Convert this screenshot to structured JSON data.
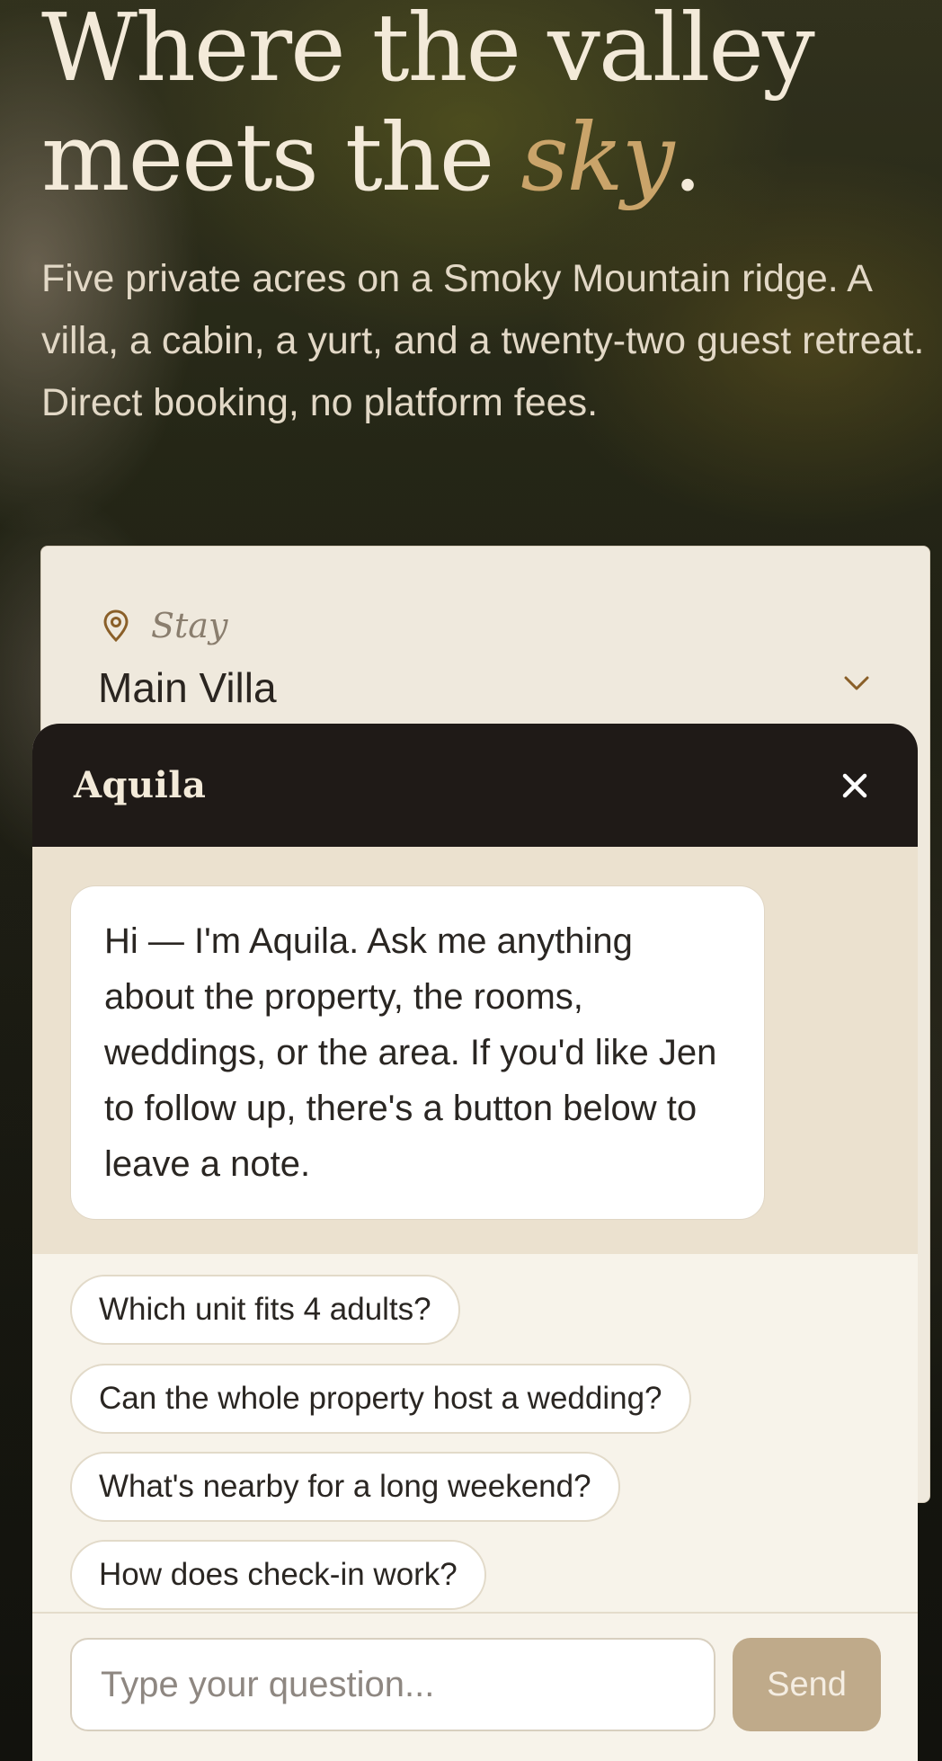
{
  "hero": {
    "headline_part1": "Where the valley meets the ",
    "headline_accent": "sky",
    "headline_end": ".",
    "subhead": "Five private acres on a Smoky Mountain ridge. A villa, a cabin, a yurt, and a twenty-two guest retreat. Direct booking, no platform fees."
  },
  "booking": {
    "stay_label": "Stay",
    "stay_value": "Main Villa",
    "icons": {
      "location": "map-pin-icon",
      "dropdown": "chevron-down-icon"
    }
  },
  "chat": {
    "title": "Aquila",
    "close_icon": "close-icon",
    "greeting": "Hi — I'm Aquila. Ask me anything about the property, the rooms, weddings, or the area. If you'd like Jen to follow up, there's a button below to leave a note.",
    "suggestions": [
      "Which unit fits 4 adults?",
      "Can the whole property host a wedding?",
      "What's nearby for a long weekend?",
      "How does check-in work?"
    ],
    "input_placeholder": "Type your question...",
    "send_label": "Send"
  },
  "colors": {
    "accent": "#caa46a",
    "chat_header": "#1f1a17",
    "send_button": "#bfaa8a",
    "message_area": "#ebe1cf"
  }
}
